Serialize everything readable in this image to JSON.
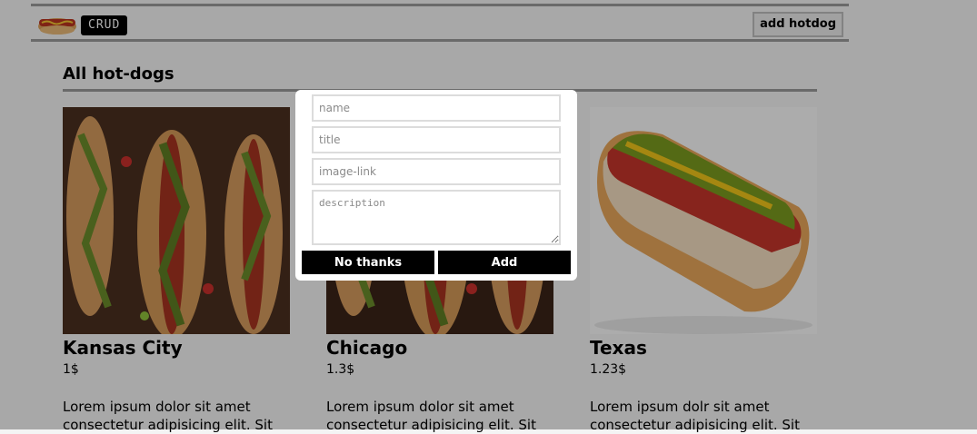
{
  "header": {
    "logo_icon": "hotdog-logo-icon",
    "badge": "CRUD",
    "add_button": "add hotdog"
  },
  "section": {
    "title": "All hot-dogs"
  },
  "cards": [
    {
      "name": "Kansas City",
      "price": "1$",
      "description": "Lorem ipsum dolor sit amet consectetur adipisicing elit. Sit"
    },
    {
      "name": "Chicago",
      "price": "1.3$",
      "description": "Lorem ipsum dolor sit amet consectetur adipisicing elit. Sit"
    },
    {
      "name": "Texas",
      "price": "1.23$",
      "description": "Lorem ipsum dolr sit amet consectetur adipisicing elit. Sit"
    }
  ],
  "modal": {
    "name_placeholder": "name",
    "title_placeholder": "title",
    "image_placeholder": "image-link",
    "description_placeholder": "description",
    "cancel_label": "No thanks",
    "add_label": "Add"
  },
  "colors": {
    "overlay": "#000000",
    "button": "#000000",
    "rule": "#9a9a9a"
  }
}
